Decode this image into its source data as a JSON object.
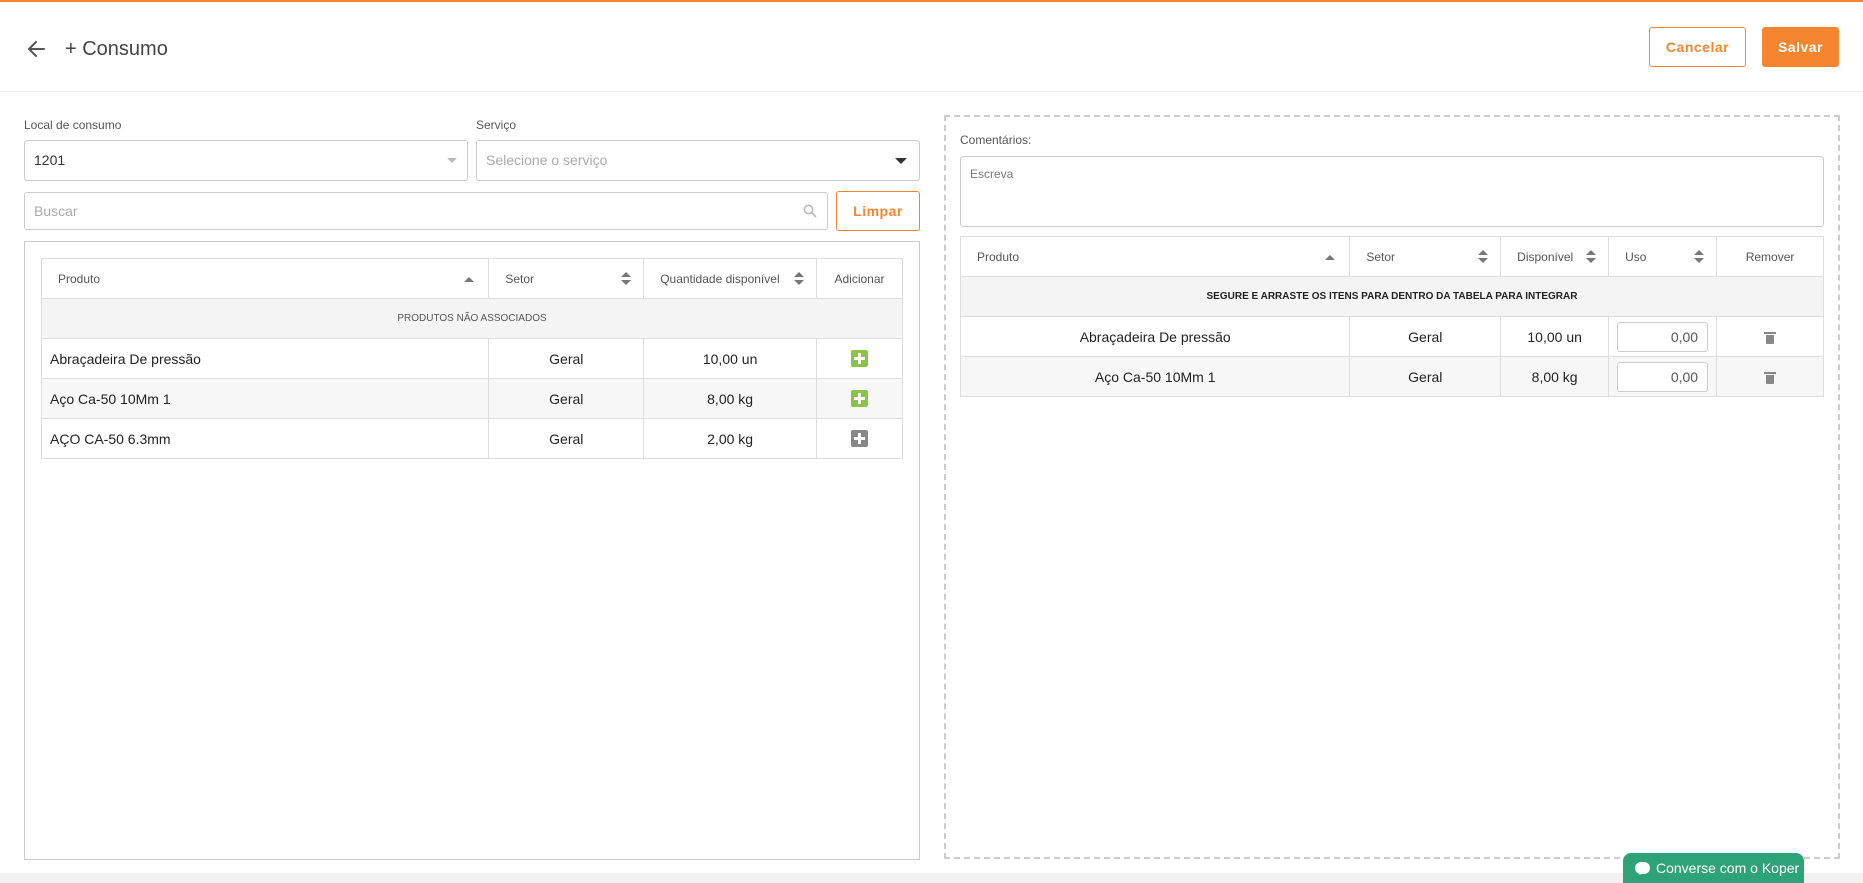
{
  "header": {
    "title": "+ Consumo",
    "cancel_label": "Cancelar",
    "save_label": "Salvar",
    "accent_color": "#f5852f"
  },
  "filters": {
    "local_label": "Local de consumo",
    "local_value": "1201",
    "service_label": "Serviço",
    "service_placeholder": "Selecione o serviço",
    "search_placeholder": "Buscar",
    "clear_label": "Limpar"
  },
  "products_table": {
    "columns": [
      "Produto",
      "Setor",
      "Quantidade disponível",
      "Adicionar"
    ],
    "group_label": "PRODUTOS NÃO ASSOCIADOS",
    "rows": [
      {
        "produto": "Abraçadeira De pressão",
        "setor": "Geral",
        "quantidade": "10,00 un",
        "add_state": "green"
      },
      {
        "produto": "Aço Ca-50 10Mm 1",
        "setor": "Geral",
        "quantidade": "8,00 kg",
        "add_state": "green"
      },
      {
        "produto": "AÇO CA-50 6.3mm",
        "setor": "Geral",
        "quantidade": "2,00 kg",
        "add_state": "gray"
      }
    ]
  },
  "comments": {
    "label": "Comentários:",
    "placeholder": "Escreva"
  },
  "consumption_table": {
    "columns": [
      "Produto",
      "Setor",
      "Disponível",
      "Uso",
      "Remover"
    ],
    "drag_hint": "SEGURE E ARRASTE OS ITENS PARA DENTRO DA TABELA PARA INTEGRAR",
    "rows": [
      {
        "produto": "Abraçadeira De pressão",
        "setor": "Geral",
        "disponivel": "10,00 un",
        "uso": "0,00"
      },
      {
        "produto": "Aço Ca-50 10Mm 1",
        "setor": "Geral",
        "disponivel": "8,00 kg",
        "uso": "0,00"
      }
    ]
  },
  "chat": {
    "label": "Converse com o Koper",
    "color": "#2ea37a"
  }
}
